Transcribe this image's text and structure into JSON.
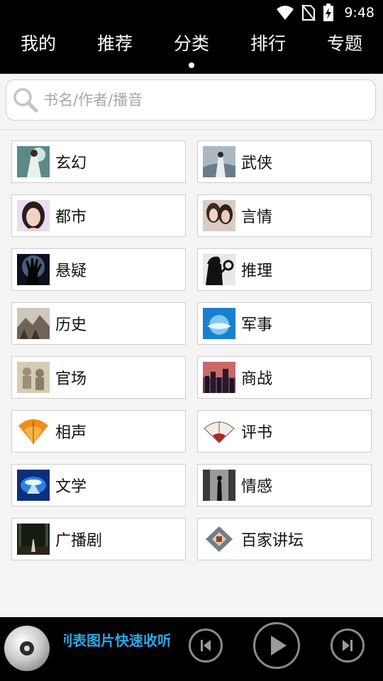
{
  "status_bar": {
    "time": "9:48",
    "icons": [
      "wifi-icon",
      "no-sim-icon",
      "battery-charging-icon"
    ]
  },
  "top_nav": {
    "tabs": [
      {
        "label": "我的",
        "active": false
      },
      {
        "label": "推荐",
        "active": false
      },
      {
        "label": "分类",
        "active": true
      },
      {
        "label": "排行",
        "active": false
      },
      {
        "label": "专题",
        "active": false
      }
    ]
  },
  "search": {
    "placeholder": "书名/作者/播音",
    "value": ""
  },
  "categories": [
    {
      "label": "玄幻",
      "icon": "fantasy-thumbnail"
    },
    {
      "label": "武侠",
      "icon": "martial-arts-thumbnail"
    },
    {
      "label": "都市",
      "icon": "urban-thumbnail"
    },
    {
      "label": "言情",
      "icon": "romance-thumbnail"
    },
    {
      "label": "悬疑",
      "icon": "suspense-thumbnail"
    },
    {
      "label": "推理",
      "icon": "detective-thumbnail"
    },
    {
      "label": "历史",
      "icon": "history-thumbnail"
    },
    {
      "label": "军事",
      "icon": "military-thumbnail"
    },
    {
      "label": "官场",
      "icon": "officialdom-thumbnail"
    },
    {
      "label": "商战",
      "icon": "business-thumbnail"
    },
    {
      "label": "相声",
      "icon": "crosstalk-fan-thumbnail"
    },
    {
      "label": "评书",
      "icon": "storytelling-fan-thumbnail"
    },
    {
      "label": "文学",
      "icon": "literature-thumbnail"
    },
    {
      "label": "情感",
      "icon": "emotion-thumbnail"
    },
    {
      "label": "广播剧",
      "icon": "radio-drama-thumbnail"
    },
    {
      "label": "百家讲坛",
      "icon": "lecture-room-thumbnail"
    }
  ],
  "player": {
    "now_playing": "列表图片快速收听",
    "buttons": [
      "previous-track",
      "play",
      "next-track"
    ]
  },
  "colors": {
    "nav_background": "#000000",
    "page_background": "#f4f4f4",
    "marquee_text": "#2aa7e8",
    "cell_border": "#cdcdcd"
  }
}
